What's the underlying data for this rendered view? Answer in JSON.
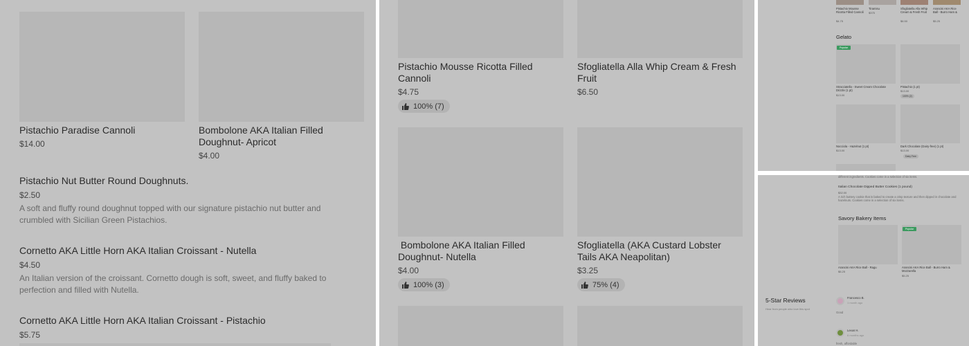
{
  "panel1": {
    "items": [
      {
        "name": "Pistachio Paradise Cannoli",
        "price": "$14.00"
      },
      {
        "name": "Bombolone AKA Italian Filled Doughnut- Apricot",
        "price": "$4.00"
      }
    ],
    "list": [
      {
        "name": "Pistachio Nut Butter Round Doughnuts.",
        "price": "$2.50",
        "desc": "A soft and fluffy round doughnut topped with our signature pistachio nut butter and crumbled with Sicilian Green Pistachios."
      },
      {
        "name": "Cornetto AKA Little Horn AKA Italian Croissant - Nutella",
        "price": "$4.50",
        "desc": "An Italian version of the croissant. Cornetto dough is soft, sweet, and fluffy baked to perfection and filled with Nutella."
      },
      {
        "name": "Cornetto AKA Little Horn AKA Italian Croissant - Pistachio",
        "price": "$5.75",
        "desc": ""
      }
    ]
  },
  "panel2": {
    "items": [
      {
        "name": "Pistachio Mousse Ricotta Filled Cannoli",
        "price": "$4.75",
        "rating": "100% (7)"
      },
      {
        "name": "Sfogliatella Alla Whip Cream & Fresh Fruit",
        "price": "$6.50",
        "rating": ""
      },
      {
        "name": " Bombolone AKA Italian Filled Doughnut- Nutella",
        "price": "$4.00",
        "rating": "100% (3)"
      },
      {
        "name": "Sfogliatella (AKA Custard Lobster Tails AKA Neapolitan)",
        "price": "$3.25",
        "rating": "75% (4)"
      }
    ]
  },
  "panel3": {
    "top_items": [
      {
        "name": "Pistachio Mousse Ricotta Filled Cannoli",
        "price": "$4.75"
      },
      {
        "name": "Tiramisu",
        "price": "$375"
      },
      {
        "name": "Sfogliatella Alla Whip Cream & Fresh Fruit",
        "price": "$6.50"
      },
      {
        "name": "Arancini AKA Rice Ball - Burro Ham &",
        "price": "$5.25"
      }
    ],
    "section": "Gelato",
    "badge": "Popular",
    "gelato": [
      {
        "name": "Stracciatella - Sweet Cream Chocolate Drizzle (1 pt)",
        "price": "$13.00",
        "chip": ""
      },
      {
        "name": "Pistachio (1 pt)",
        "price": "$13.00",
        "chip": "100% (2)"
      },
      {
        "name": "Nocciola - Hazelnut (1 pt)",
        "price": "$13.00",
        "chip": ""
      },
      {
        "name": "Dark Chocolate (Dairy-free) (1 pt)",
        "price": "$13.00",
        "chip": "Dairy Free"
      }
    ]
  },
  "panel4": {
    "top_text": "different ingredients. Cookies come in a selection of six items.",
    "cookie_name": "Italian Chocolate Dipped Butter Cookies (1 pound)",
    "cookie_price": "$32.00",
    "cookie_desc": "A rich buttery cookie that is baked to create a crisp texture and then dipped in chocolate and hazelnuts. Cookies come in a selection of six items.",
    "section": "Savory Bakery Items",
    "badge": "Popular",
    "savory": [
      {
        "name": "Arancini AKA Rice Ball - Ragu",
        "price": "$5.25"
      },
      {
        "name": "Arancini AKA Rice Ball - Burro Ham & Mozzarella",
        "price": "$5.25"
      }
    ],
    "reviews_title": "5-Star Reviews",
    "reviews_sub": "Hear from people who love this spot",
    "reviews": [
      {
        "author": "Francesco B.",
        "time": "1 month ago",
        "text": "Good"
      },
      {
        "author": "Lexus H.",
        "time": "6 months ago",
        "text": "fresh, affordable"
      }
    ]
  },
  "colors": {
    "overlay": "#c2c2c2",
    "placeholder": "#b7b7b7",
    "popular": "#3b9a5f"
  }
}
